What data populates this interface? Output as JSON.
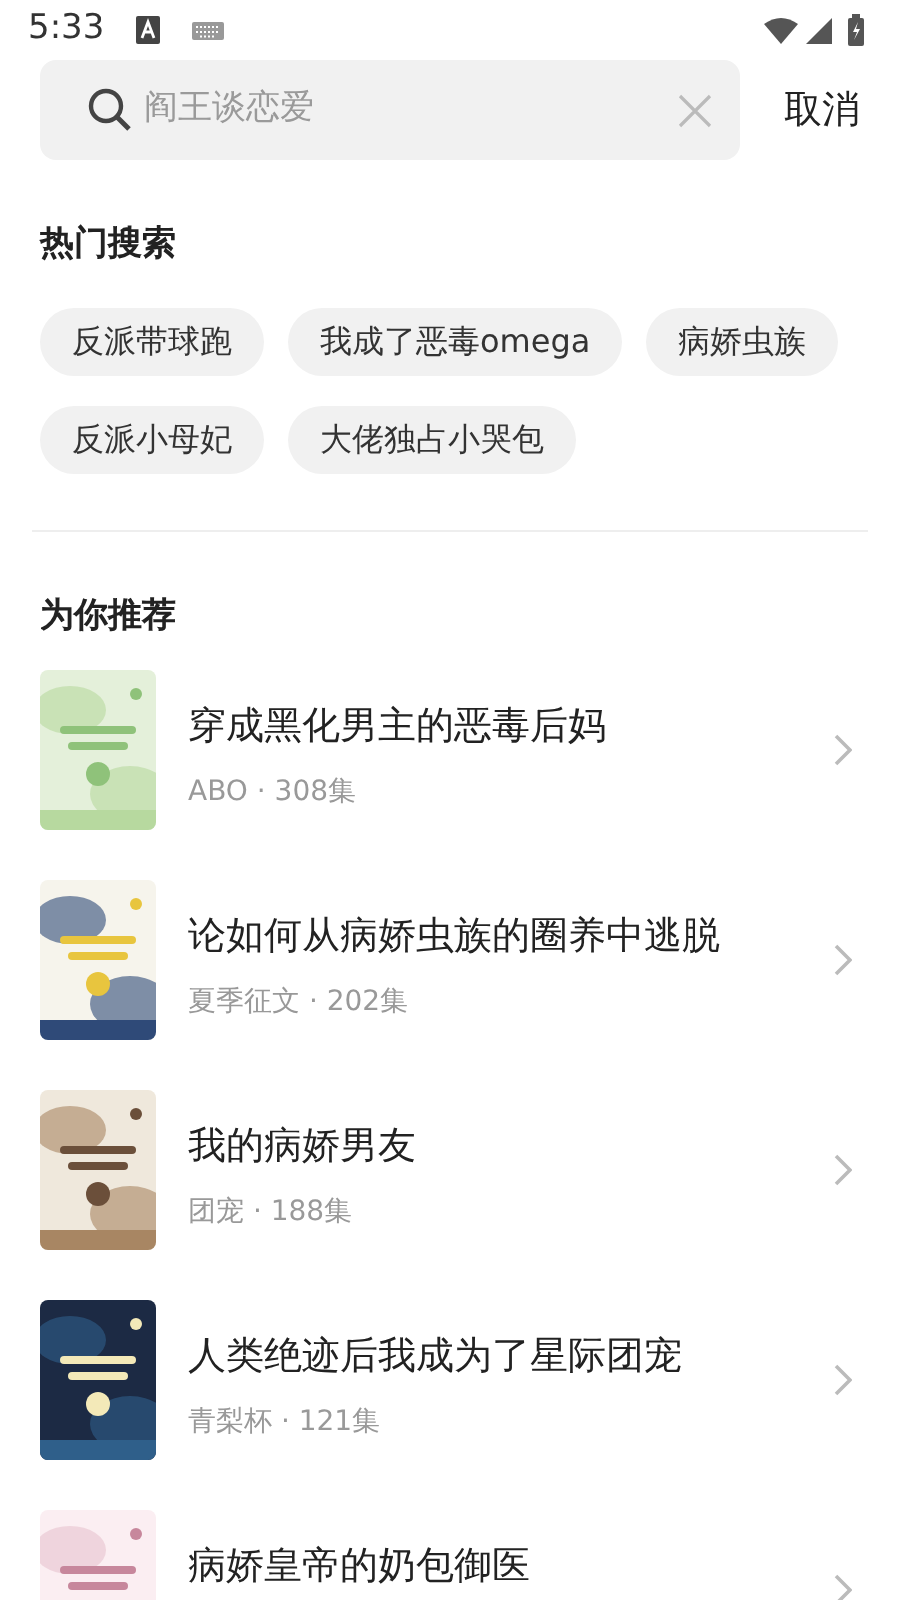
{
  "status_bar": {
    "time": "5:33"
  },
  "search": {
    "placeholder": "阎王谈恋爱",
    "cancel": "取消"
  },
  "hot_searches": {
    "title": "热门搜索",
    "tags": [
      {
        "label": "反派带球跑"
      },
      {
        "label": "我成了恶毒omega"
      },
      {
        "label": "病娇虫族"
      },
      {
        "label": "反派小母妃"
      },
      {
        "label": "大佬独占小哭包"
      }
    ]
  },
  "recommended": {
    "title": "为你推荐",
    "items": [
      {
        "title": "穿成黑化男主的恶毒后妈",
        "meta": "ABO · 308集"
      },
      {
        "title": "论如何从病娇虫族的圈养中逃脱",
        "meta": "夏季征文 · 202集"
      },
      {
        "title": "我的病娇男友",
        "meta": "团宠 · 188集"
      },
      {
        "title": "人类绝迹后我成为了星际团宠",
        "meta": "青梨杯 · 121集"
      },
      {
        "title": "病娇皇帝的奶包御医"
      }
    ]
  }
}
